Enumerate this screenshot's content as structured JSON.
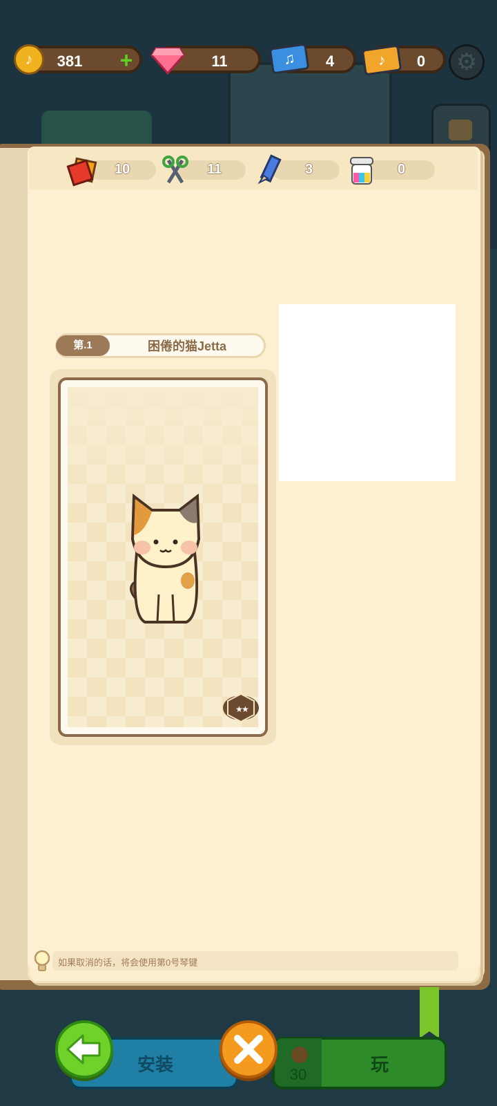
{
  "currency": {
    "coins": "381",
    "gems": "11",
    "music_tickets": "4",
    "gold_tickets": "0"
  },
  "resources": {
    "red_paper": "10",
    "scissors": "11",
    "pencil": "3",
    "paint": "0"
  },
  "level": {
    "badge": "第.1",
    "title": "困倦的猫Jetta"
  },
  "card": {
    "stars": 2,
    "character_icon": "cat-icon"
  },
  "hint": {
    "text": "如果取消的话，将会使用第0号琴键"
  },
  "bottom": {
    "install_label": "安装",
    "play_label": "玩",
    "play_cost": "30"
  },
  "colors": {
    "book_page": "#fdf0d2",
    "back_button": "#6fd12a",
    "close_button": "#f49a1e"
  }
}
